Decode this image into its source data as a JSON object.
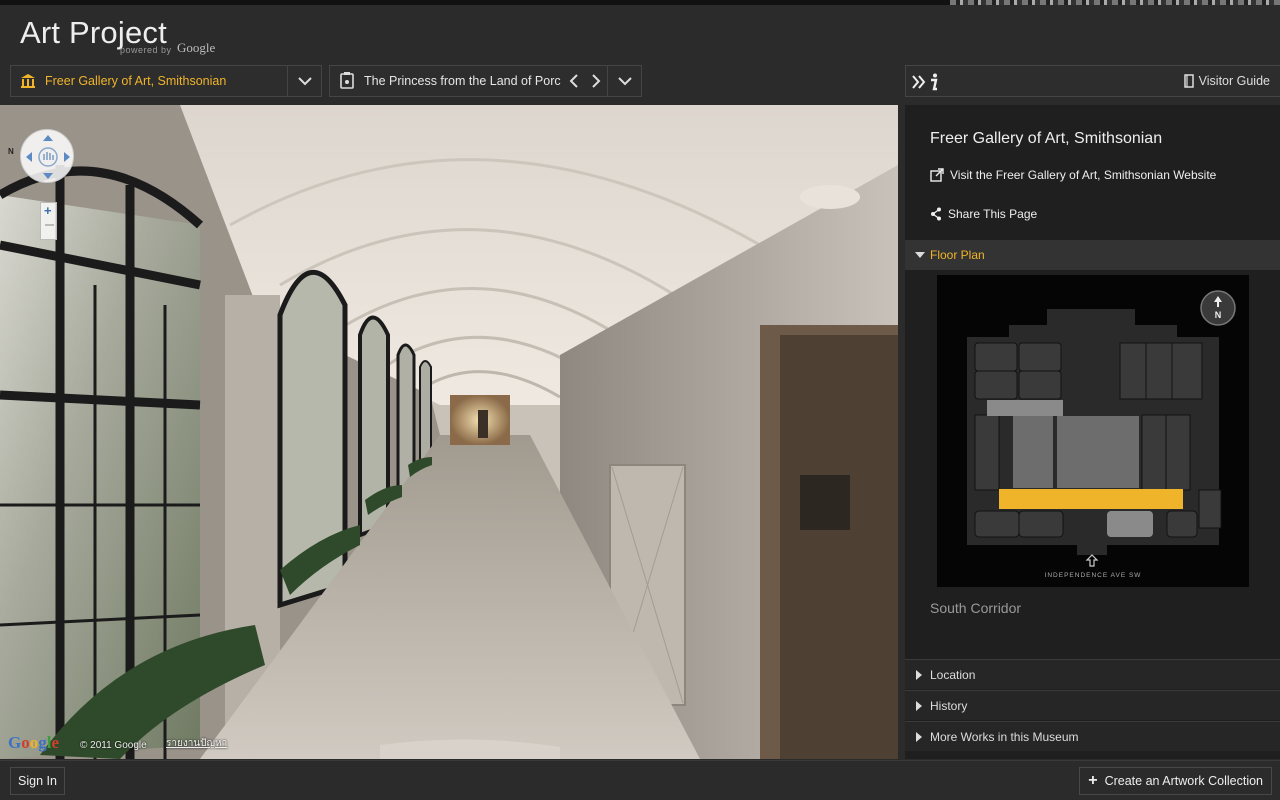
{
  "app": {
    "title": "Art Project",
    "powered_by": "powered by",
    "google": "Google"
  },
  "museum_selector": {
    "value": "Freer Gallery of Art, Smithsonian",
    "icon": "museum-icon"
  },
  "artwork_selector": {
    "value": "The Princess from the Land of Porc",
    "icon": "artwork-icon"
  },
  "sidebar_header": {
    "visitor_guide": "Visitor Guide"
  },
  "sidebar": {
    "museum_name": "Freer Gallery of Art, Smithsonian",
    "visit_link": "Visit the Freer Gallery of Art, Smithsonian Website",
    "share_link": "Share This Page",
    "floor_plan_label": "Floor Plan",
    "floor_plan_street": "INDEPENDENCE AVE SW",
    "floor_plan_north": "N",
    "room_name": "South Corridor",
    "sections": [
      {
        "label": "Location"
      },
      {
        "label": "History"
      },
      {
        "label": "More Works in this Museum"
      }
    ]
  },
  "viewer": {
    "brand": "Google",
    "copyright": "© 2011 Google",
    "report_link": "รายงานปัญหา",
    "compass": "N"
  },
  "footer": {
    "sign_in": "Sign In",
    "create_collection": "Create an Artwork Collection"
  },
  "colors": {
    "accent": "#f0b42a",
    "background": "#2b2b2b",
    "sidebar": "#1f1f1f"
  }
}
